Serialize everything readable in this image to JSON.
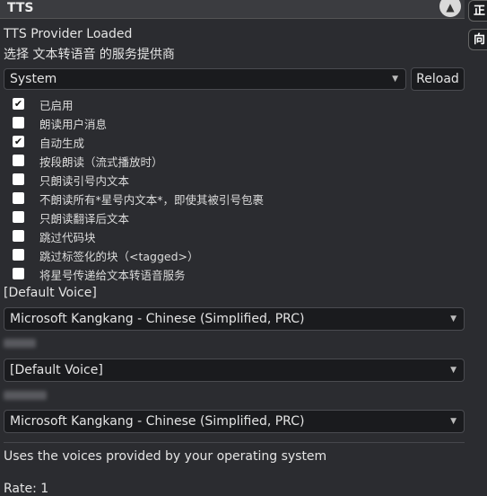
{
  "header": {
    "title": "TTS",
    "collapse_icon": "chevron-up-icon"
  },
  "side_tabs": [
    {
      "label": "正"
    },
    {
      "label": "向"
    }
  ],
  "status": "TTS Provider Loaded",
  "provider_prompt": "选择 文本转语音 的服务提供商",
  "provider_select": {
    "value": "System"
  },
  "reload_label": "Reload",
  "options": [
    {
      "label": "已启用",
      "checked": true
    },
    {
      "label": "朗读用户消息",
      "checked": false
    },
    {
      "label": "自动生成",
      "checked": true
    },
    {
      "label": "按段朗读（流式播放时）",
      "checked": false
    },
    {
      "label": "只朗读引号内文本",
      "checked": false
    },
    {
      "label": "不朗读所有*星号内文本*，即使其被引号包裹",
      "checked": false
    },
    {
      "label": "只朗读翻译后文本",
      "checked": false
    },
    {
      "label": "跳过代码块",
      "checked": false
    },
    {
      "label": "跳过标签化的块（<tagged>）",
      "checked": false
    },
    {
      "label": "将星号传递给文本转语音服务",
      "checked": false
    }
  ],
  "default_voice_label": "[Default Voice]",
  "voice_select_1": "Microsoft Kangkang - Chinese (Simplified, PRC)",
  "voice_select_2": "[Default Voice]",
  "voice_select_3": "Microsoft Kangkang - Chinese (Simplified, PRC)",
  "description": "Uses the voices provided by your operating system",
  "rate_label": "Rate: 1"
}
